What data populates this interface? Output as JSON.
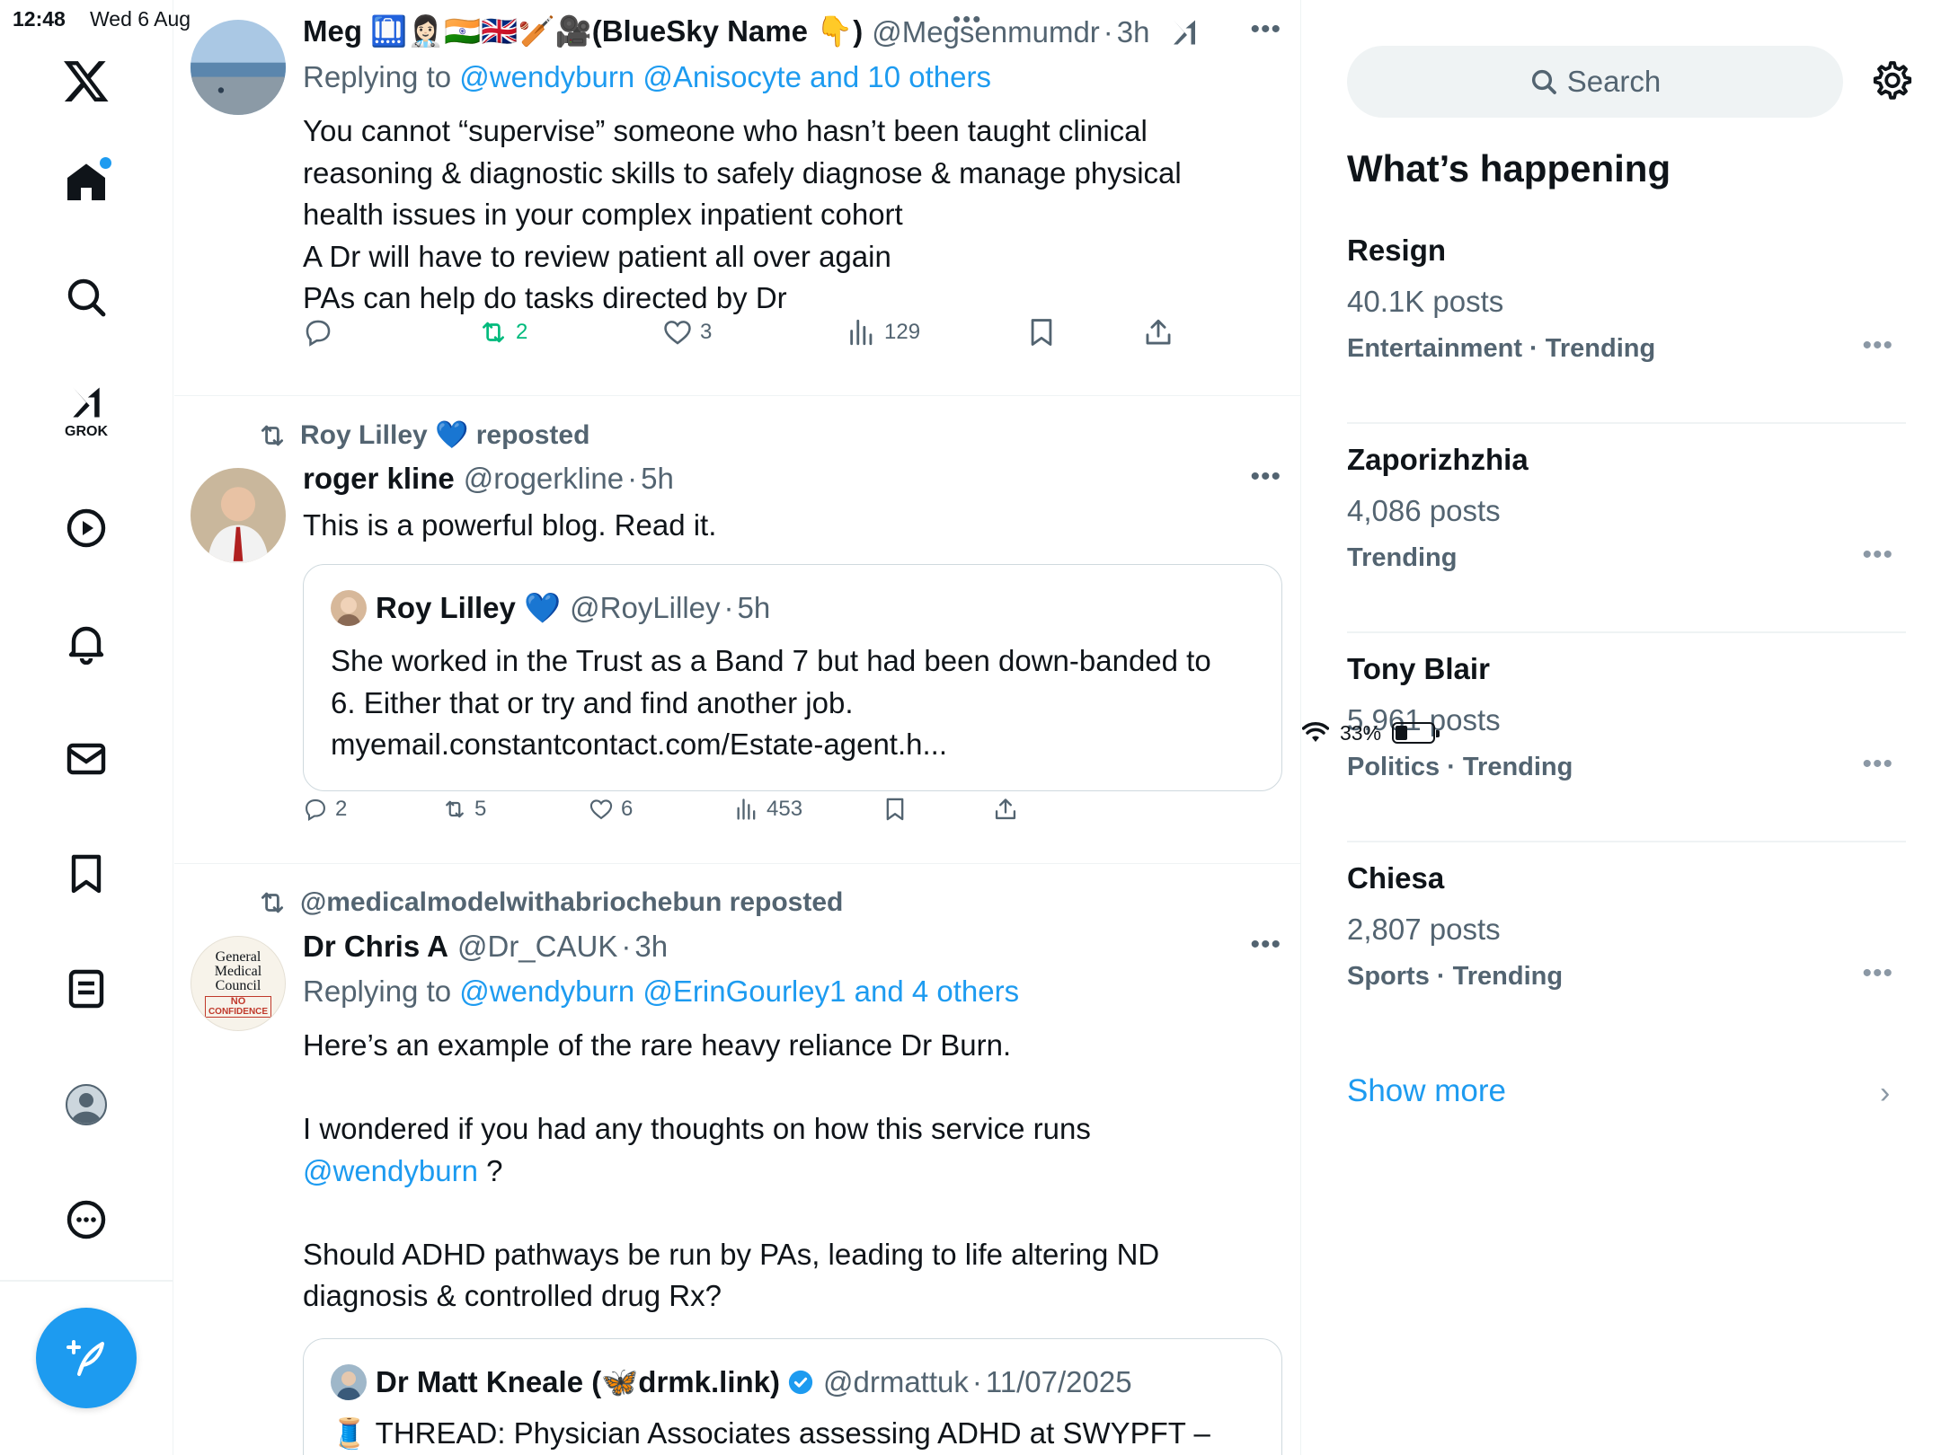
{
  "status": {
    "time": "12:48",
    "date": "Wed 6 Aug",
    "battery": "33%",
    "battery_level": 0.33
  },
  "nav": {
    "grok_label": "GROK"
  },
  "feed": {
    "tweets": [
      {
        "name": "Meg 🛄👩🏻‍⚕️🇮🇳🇬🇧🏏🎥(BlueSky Name 👇)",
        "handle": "@Megsenmumdr",
        "time": "3h",
        "reply_prefix": "Replying to",
        "reply_targets": "@wendyburn @Anisocyte and 10 others",
        "body": [
          "You cannot “supervise” someone who hasn’t been taught clinical",
          "reasoning & diagnostic skills to safely diagnose & manage physical",
          "health issues in your complex inpatient cohort",
          "A Dr will have to review patient all over again",
          "PAs can help do tasks directed by Dr"
        ],
        "stats": {
          "replies": "",
          "reposts": "2",
          "likes": "3",
          "views": "129"
        }
      },
      {
        "repost_by": "Roy Lilley 💙 reposted",
        "name": "roger kline",
        "handle": "@rogerkline",
        "time": "5h",
        "body": [
          "This is a powerful blog. Read it."
        ],
        "quote": {
          "name": "Roy Lilley 💙",
          "handle": "@RoyLilley",
          "time": "5h",
          "body": [
            "She worked in the Trust as a Band 7 but had been down-banded to",
            "6. Either that or try and find another job.",
            "myemail.constantcontact.com/Estate-agent.h..."
          ]
        },
        "stats": {
          "replies": "2",
          "reposts": "5",
          "likes": "6",
          "views": "453"
        }
      },
      {
        "repost_by": "@medicalmodelwithabriochebun reposted",
        "name": "Dr Chris A",
        "handle": "@Dr_CAUK",
        "time": "3h",
        "avatar_text": [
          "General",
          "Medical",
          "Council",
          "NO",
          "CONFIDENCE"
        ],
        "reply_prefix": "Replying to",
        "reply_targets": "@wendyburn @ErinGourley1 and 4 others",
        "body_1": "Here’s an example of the rare heavy reliance Dr Burn.",
        "body_2": "I wondered if you had any thoughts on how this service runs",
        "mention": "@wendyburn",
        "mention_suffix": " ?",
        "body_3": "Should ADHD pathways be run by PAs, leading to life altering ND",
        "body_4": "diagnosis & controlled drug Rx?",
        "quote": {
          "name": "Dr Matt Kneale (🦋drmk.link)",
          "handle": "@drmattuk",
          "time": "11/07/2025",
          "body": [
            "🧵 THREAD: Physician Associates assessing ADHD at SWYPFT –"
          ]
        }
      }
    ]
  },
  "sidebar": {
    "search_placeholder": "Search",
    "title": "What’s happening",
    "trends": [
      {
        "name": "Resign",
        "posts": "40.1K posts",
        "meta": "Entertainment · Trending"
      },
      {
        "name": "Zaporizhzhia",
        "posts": "4,086 posts",
        "meta": "Trending"
      },
      {
        "name": "Tony Blair",
        "posts": "5,961 posts",
        "meta": "Politics · Trending"
      },
      {
        "name": "Chiesa",
        "posts": "2,807 posts",
        "meta": "Sports · Trending"
      }
    ],
    "show_more": "Show more"
  },
  "colors": {
    "accent": "#1d9bf0",
    "text": "#0f1419",
    "muted": "#536471",
    "repost_green": "#00ba7c"
  },
  "icons": [
    "x-logo-icon",
    "home-icon",
    "search-icon",
    "grok-icon",
    "video-icon",
    "bell-icon",
    "mail-icon",
    "bookmark-icon",
    "list-icon",
    "profile-icon",
    "more-icon",
    "compose-icon",
    "reply-icon",
    "repost-icon",
    "like-icon",
    "views-icon",
    "share-icon",
    "gear-icon",
    "chevron-right-icon"
  ]
}
